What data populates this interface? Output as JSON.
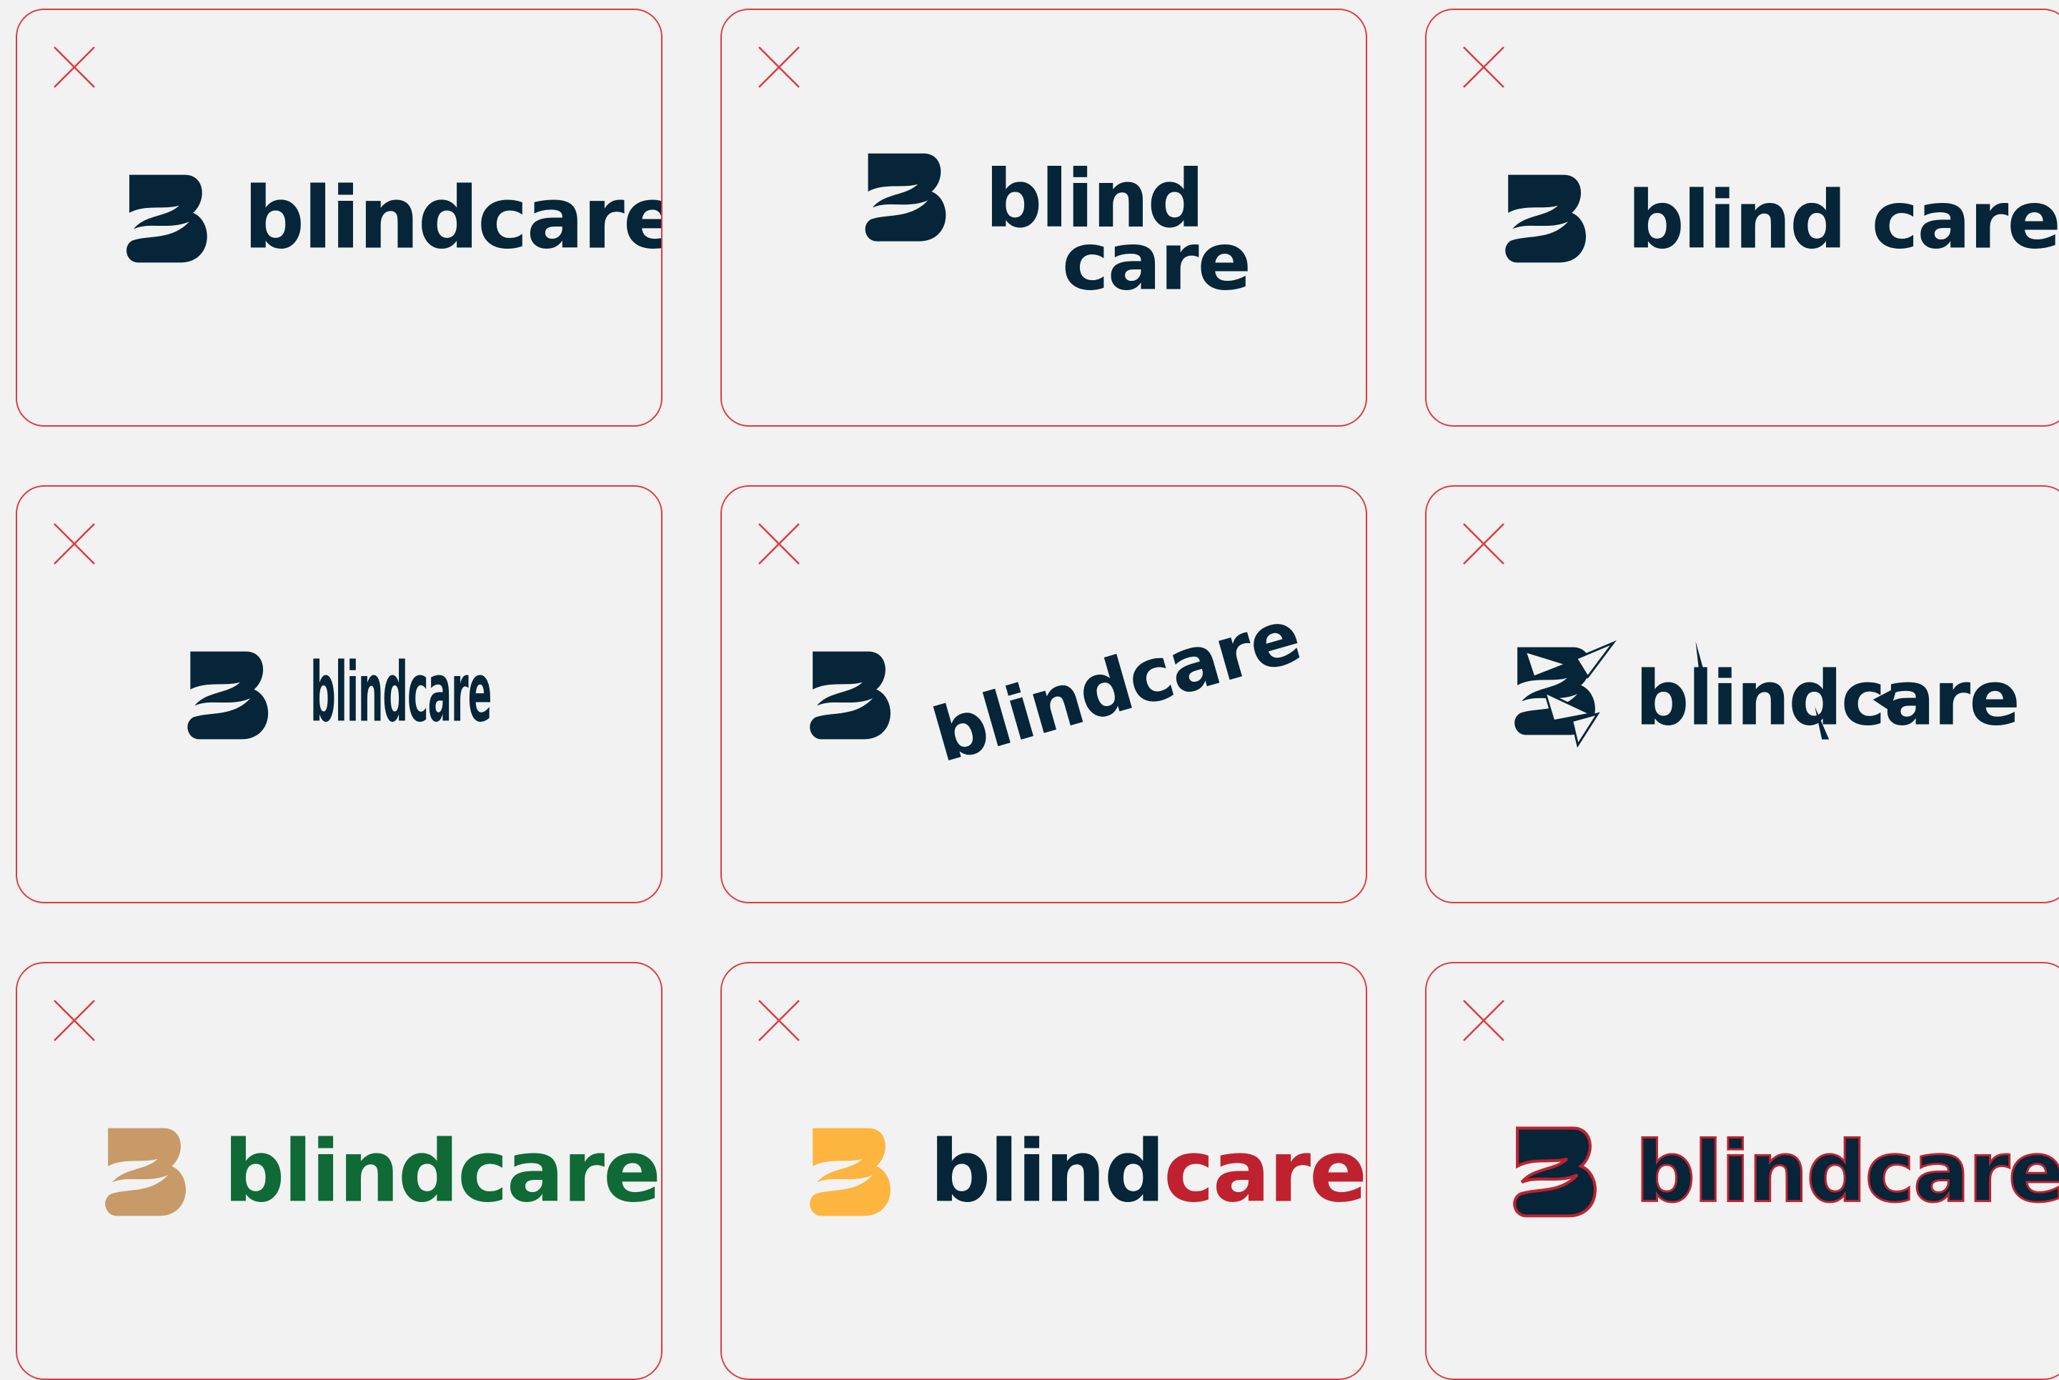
{
  "colors": {
    "background": "#f1f2f1",
    "frame": "#e03a3e",
    "navy": "#062538",
    "tan": "#c79a68",
    "green": "#0f6a36",
    "yellow": "#fdb53f",
    "red": "#c0212f"
  },
  "icons": {
    "cross": "cross-mark-icon",
    "mark": "b-logo-mark-icon"
  },
  "variants": [
    {
      "wordmark": "blindcare"
    },
    {
      "line1": "blind",
      "line2": "care"
    },
    {
      "wordmark": "blind care"
    },
    {
      "wordmark": "blindcare"
    },
    {
      "wordmark": "blindcare"
    },
    {
      "wordmark": "blindcare"
    },
    {
      "wordmark": "blindcare"
    },
    {
      "part1": "blind",
      "part2": "care"
    },
    {
      "wordmark": "blindcare"
    }
  ]
}
